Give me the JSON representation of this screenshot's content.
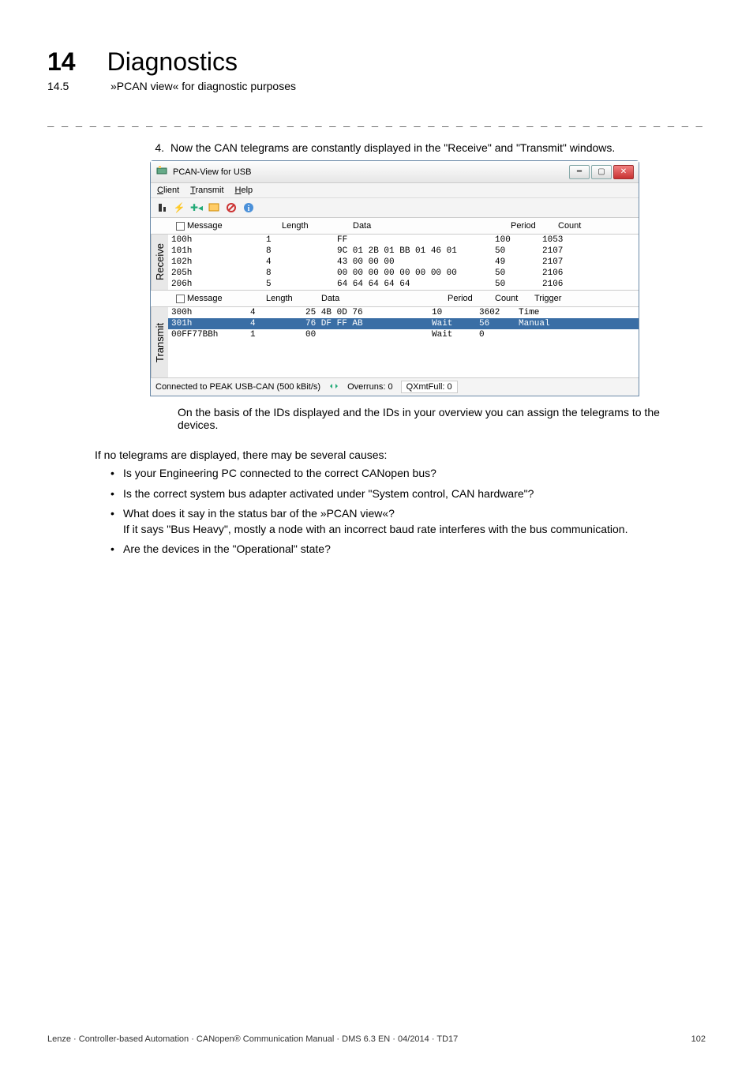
{
  "header": {
    "chapter_number": "14",
    "chapter_title": "Diagnostics",
    "section_number": "14.5",
    "section_title": "»PCAN view« for diagnostic purposes"
  },
  "separator": "_ _ _ _ _ _ _ _ _ _ _ _ _ _ _ _ _ _ _ _ _ _ _ _ _ _ _ _ _ _ _ _ _ _ _ _ _ _ _ _ _ _ _ _ _ _ _ _ _ _ _ _ _ _ _ _ _ _ _ _ _ _ _ _",
  "step": {
    "number": "4.",
    "text": "Now the CAN telegrams are constantly displayed in the \"Receive\" and \"Transmit\" windows."
  },
  "window": {
    "title": "PCAN-View for USB",
    "menus": {
      "client": "Client",
      "transmit": "Transmit",
      "help": "Help"
    },
    "receive": {
      "tab_label": "Receive",
      "columns": {
        "message": "Message",
        "length": "Length",
        "data": "Data",
        "period": "Period",
        "count": "Count"
      },
      "rows": [
        {
          "message": "100h",
          "length": "1",
          "data": "FF",
          "period": "100",
          "count": "1053"
        },
        {
          "message": "101h",
          "length": "8",
          "data": "9C 01 2B 01 BB 01 46 01",
          "period": "50",
          "count": "2107"
        },
        {
          "message": "102h",
          "length": "4",
          "data": "43 00 00 00",
          "period": "49",
          "count": "2107"
        },
        {
          "message": "205h",
          "length": "8",
          "data": "00 00 00 00 00 00 00 00",
          "period": "50",
          "count": "2106"
        },
        {
          "message": "206h",
          "length": "5",
          "data": "64 64 64 64 64",
          "period": "50",
          "count": "2106"
        }
      ]
    },
    "transmit": {
      "tab_label": "Transmit",
      "columns": {
        "message": "Message",
        "length": "Length",
        "data": "Data",
        "period": "Period",
        "count": "Count",
        "trigger": "Trigger"
      },
      "rows": [
        {
          "message": "300h",
          "length": "4",
          "data": "25 4B 0D 76",
          "period": "10",
          "count": "3602",
          "trigger": "Time"
        },
        {
          "message": "301h",
          "length": "4",
          "data": "76 DF FF AB",
          "period": "Wait",
          "count": "56",
          "trigger": "Manual"
        },
        {
          "message": "00FF77BBh",
          "length": "1",
          "data": "00",
          "period": "Wait",
          "count": "0",
          "trigger": ""
        }
      ]
    },
    "status": {
      "connected": "Connected to PEAK USB-CAN (500 kBit/s)",
      "overruns": "Overruns: 0",
      "qxmit": "QXmtFull: 0"
    }
  },
  "after_window_text": "On the basis of the IDs displayed and the IDs in your overview you can assign the telegrams to the devices.",
  "paragraph": "If no telegrams are displayed, there may be several causes:",
  "bullets": [
    "Is your Engineering PC connected to the correct CANopen bus?",
    "Is the correct system bus adapter activated under \"System control, CAN hardware\"?",
    "What does it say in the status bar of the »PCAN view«?\nIf it says \"Bus Heavy\", mostly a node with an incorrect baud rate interferes with the bus communication.",
    "Are the devices in the \"Operational\" state?"
  ],
  "footer": {
    "left": "Lenze · Controller-based Automation · CANopen® Communication Manual · DMS 6.3 EN · 04/2014 · TD17",
    "right": "102"
  }
}
